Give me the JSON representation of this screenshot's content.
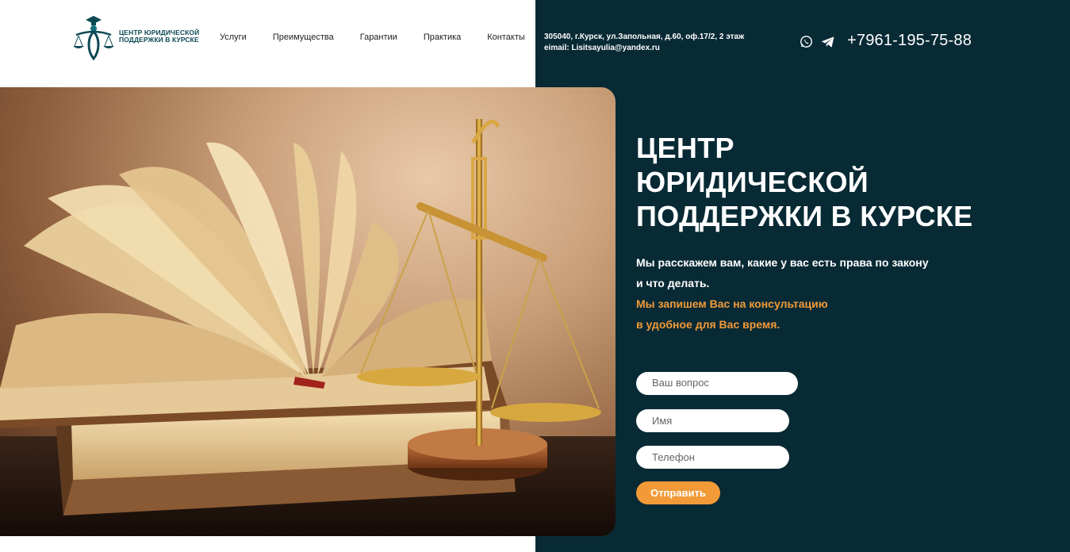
{
  "brand": {
    "logo_line1": "ЦЕНТР ЮРИДИЧЕСКОЙ",
    "logo_line2": "ПОДДЕРЖКИ В КУРСКЕ"
  },
  "nav": {
    "items": [
      "Услуги",
      "Преимущества",
      "Гарантии",
      "Практика",
      "Контакты"
    ]
  },
  "contact": {
    "address": "305040, г.Курск, ул.Запольная, д.60, оф.17/2, 2 этаж",
    "email": "eimail: Lisitsayulia@yandex.ru",
    "phone": "+7961-195-75-88",
    "icons": [
      "whatsapp-icon",
      "telegram-icon"
    ]
  },
  "hero": {
    "title_line1": "ЦЕНТР",
    "title_line2": "ЮРИДИЧЕСКОЙ",
    "title_line3": "ПОДДЕРЖКИ В КУРСКЕ",
    "lead_line1": "Мы расскажем вам, какие у вас есть права по закону",
    "lead_line2": "и что делать.",
    "accent_line1": "Мы запишем Вас на консультацию",
    "accent_line2": "в удобное для Вас время."
  },
  "form": {
    "question_placeholder": "Ваш вопрос",
    "name_placeholder": "Имя",
    "phone_placeholder": "Телефон",
    "submit_label": "Отправить"
  },
  "colors": {
    "dark_panel": "#082a35",
    "accent": "#f29a38",
    "brand": "#0d4a55"
  }
}
